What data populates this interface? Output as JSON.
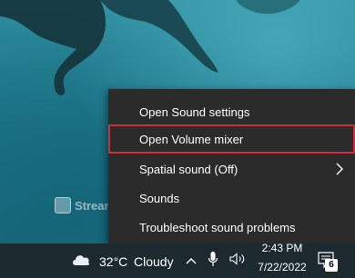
{
  "context_menu": {
    "items": [
      {
        "label": "Open Sound settings",
        "highlighted": false,
        "has_submenu": false
      },
      {
        "label": "Open Volume mixer",
        "highlighted": true,
        "has_submenu": false
      },
      {
        "label": "Spatial sound (Off)",
        "highlighted": false,
        "has_submenu": true
      },
      {
        "label": "Sounds",
        "highlighted": false,
        "has_submenu": false
      },
      {
        "label": "Troubleshoot sound problems",
        "highlighted": false,
        "has_submenu": false
      }
    ],
    "highlight_color": "#c8303a"
  },
  "watermark": {
    "text": "StreamFox"
  },
  "taskbar": {
    "weather": {
      "icon": "cloud-icon",
      "temperature": "32°C",
      "condition": "Cloudy"
    },
    "tray_icons": [
      "chevron-up-icon",
      "microphone-icon",
      "speaker-icon"
    ],
    "clock": {
      "time": "2:43 PM",
      "date": "7/22/2022"
    },
    "notifications": {
      "icon": "notification-icon",
      "count": "6"
    }
  }
}
